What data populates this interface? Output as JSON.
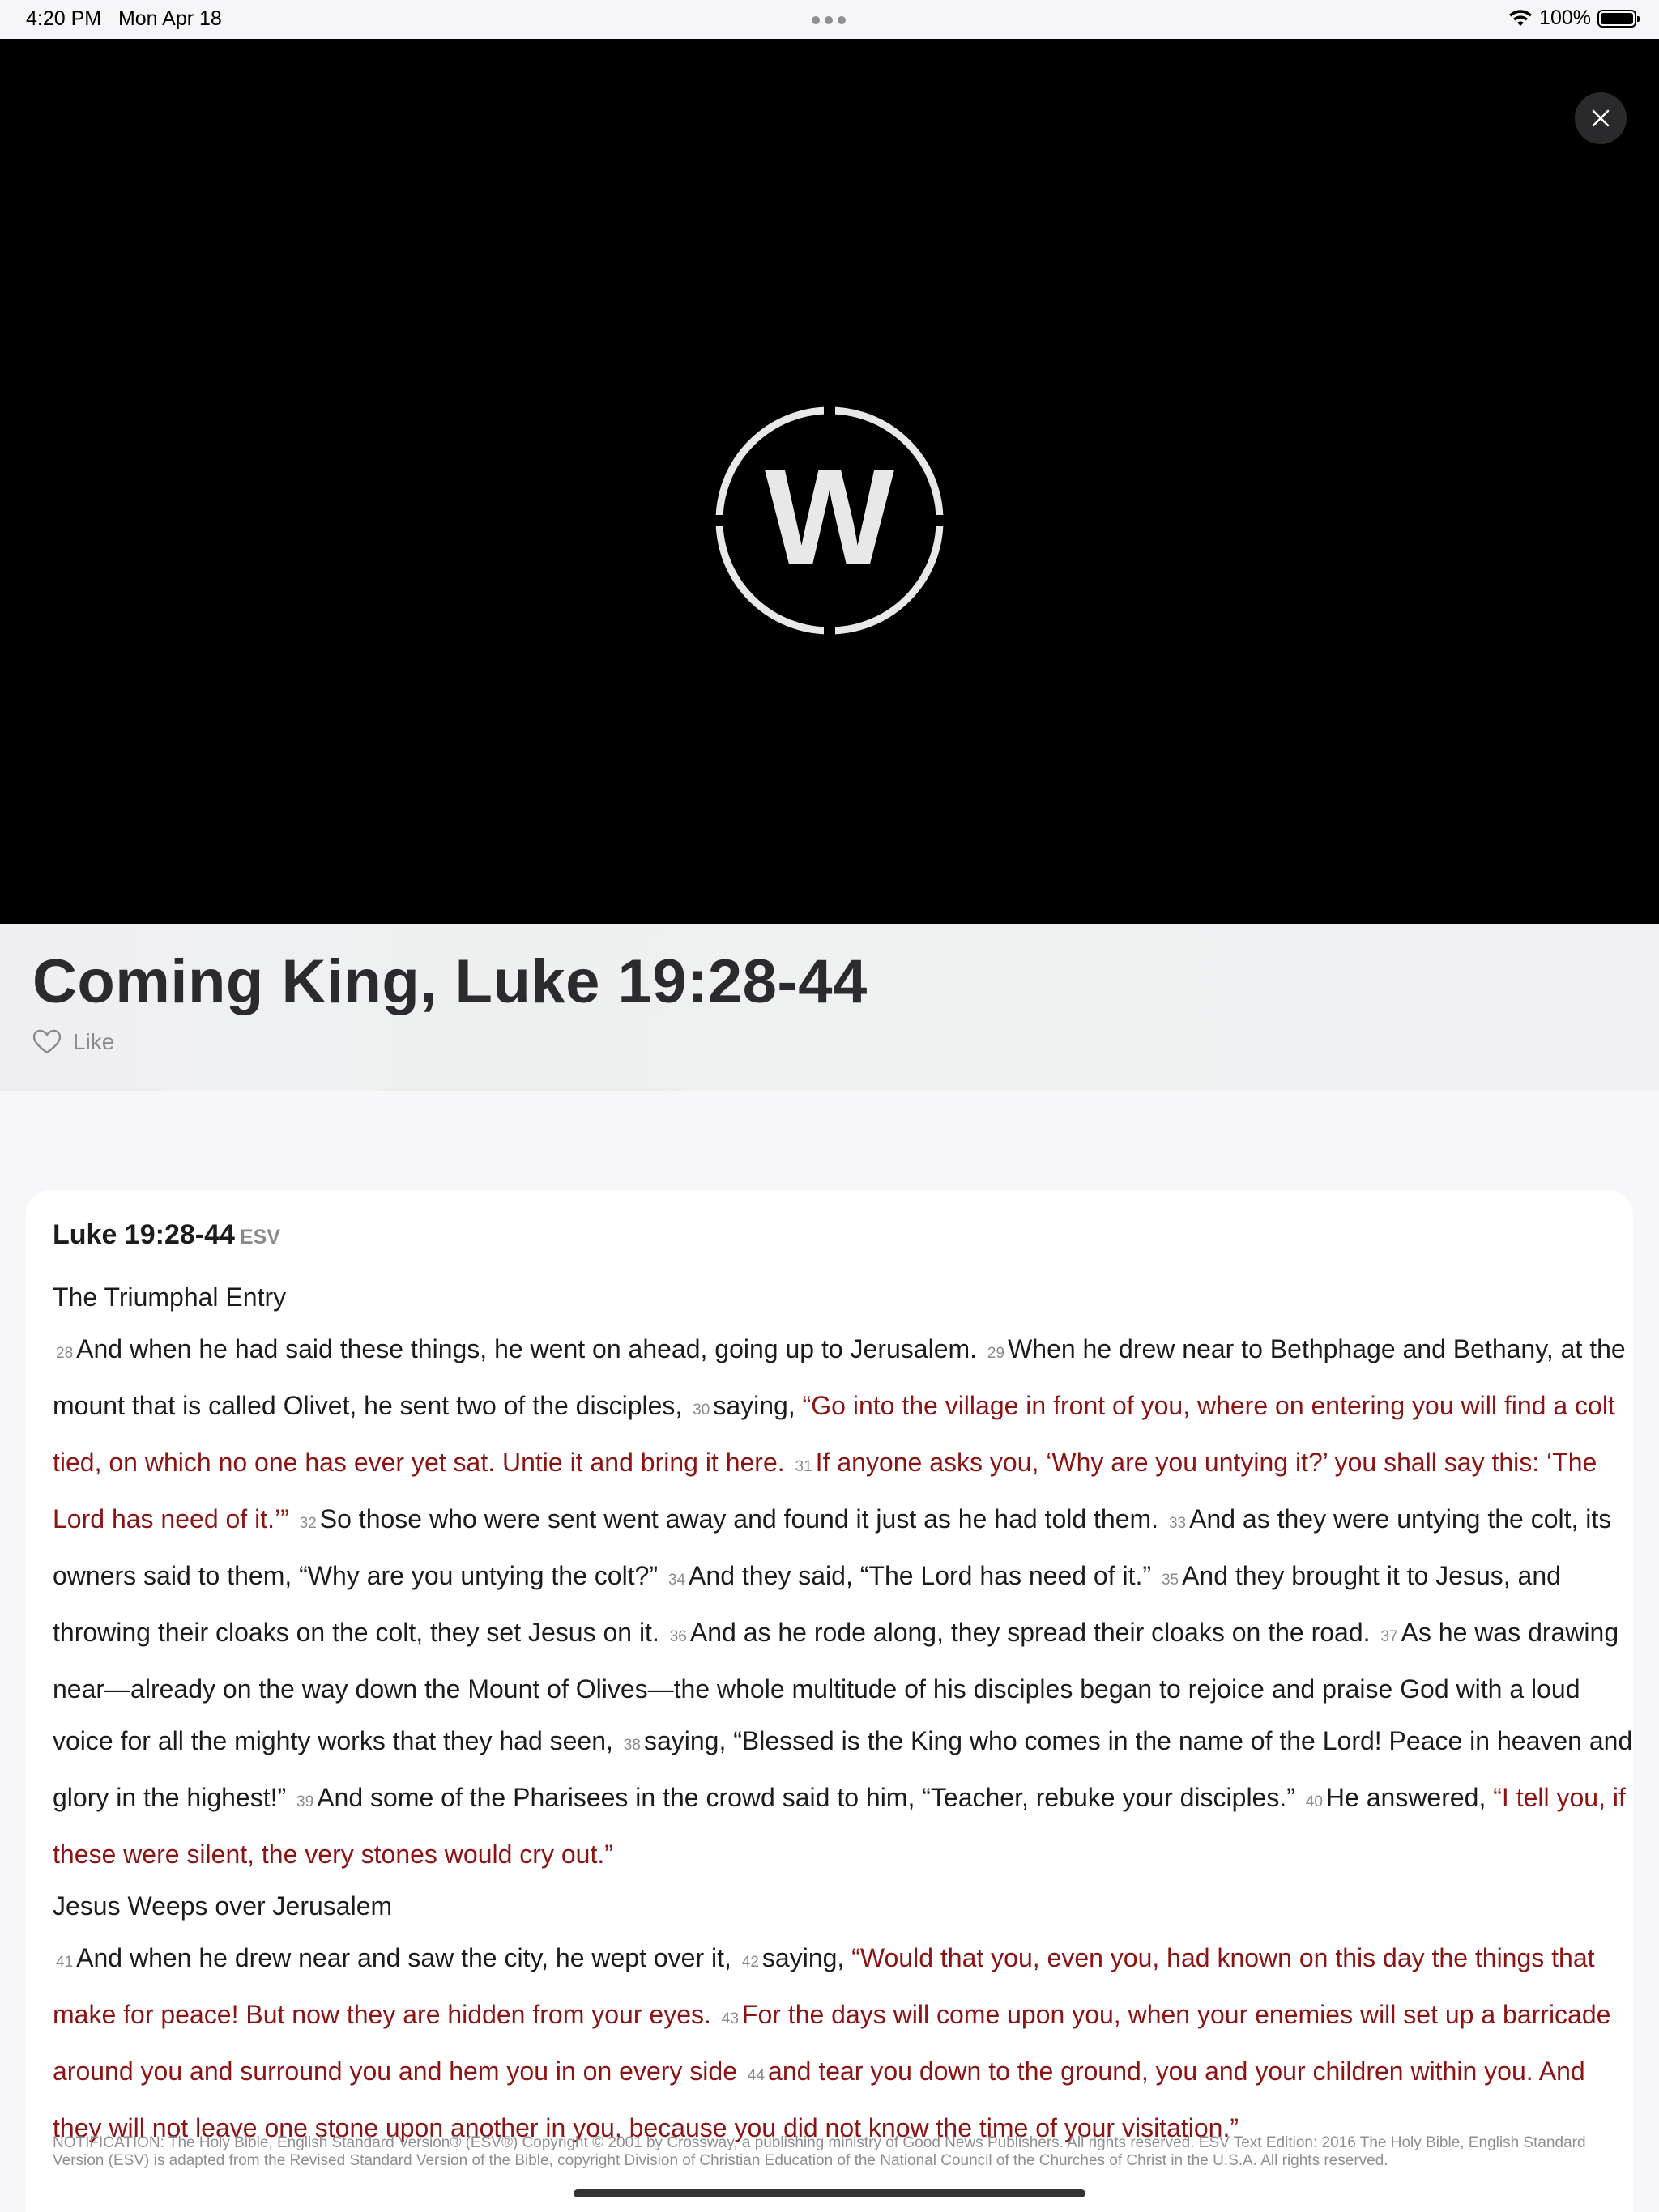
{
  "status_bar": {
    "time": "4:20 PM",
    "date": "Mon Apr 18",
    "battery": "100%"
  },
  "video": {
    "logo_letter": "W"
  },
  "header": {
    "title": "Coming King, Luke 19:28-44",
    "like_label": "Like"
  },
  "passage": {
    "reference": "Luke 19:28-44",
    "version": "ESV",
    "heading1": "The Triumphal Entry",
    "heading2": "Jesus Weeps over Jerusalem",
    "v28": "And when he had said these things, he went on ahead, going up to Jerusalem.",
    "v29": "When he drew near to Bethphage and Bethany, at the mount that is called Olivet, he sent two of the disciples,",
    "v30a": "saying,",
    "v30b": "“Go into the village in front of you, where on entering you will find a colt tied, on which no one has ever yet sat. Untie it and bring it here.",
    "v31": "If anyone asks you, ‘Why are you untying it?’ you shall say this: ‘The Lord has need of it.’”",
    "v32": "So those who were sent went away and found it just as he had told them.",
    "v33": "And as they were untying the colt, its owners said to them, “Why are you untying the colt?”",
    "v34": "And they said, “The Lord has need of it.”",
    "v35": "And they brought it to Jesus, and throwing their cloaks on the colt, they set Jesus on it.",
    "v36": "And as he rode along, they spread their cloaks on the road.",
    "v37": "As he was drawing near—already on the way down the Mount of Olives—the whole multitude of his disciples began to rejoice and praise God with a loud voice for all the mighty works that they had seen,",
    "v38": "saying, “Blessed is the King who comes in the name of the Lord! Peace in heaven and glory in the highest!”",
    "v39": "And some of the Pharisees in the crowd said to him, “Teacher, rebuke your disciples.”",
    "v40a": "He answered,",
    "v40b": "“I tell you, if these were silent, the very stones would cry out.”",
    "v41": "And when he drew near and saw the city, he wept over it,",
    "v42a": "saying,",
    "v42b": "“Would that you, even you, had known on this day the things that make for peace! But now they are hidden from your eyes.",
    "v43": "For the days will come upon you, when your enemies will set up a barricade around you and surround you and hem you in on every side",
    "v44": "and tear you down to the ground, you and your children within you. And they will not leave one stone upon another in you, because you did not know the time of your visitation.”",
    "notice": "NOTIFICATION: The Holy Bible, English Standard Version® (ESV®) Copyright © 2001 by Crossway, a publishing ministry of Good News Publishers. All rights reserved. ESV Text Edition: 2016 The Holy Bible, English Standard Version (ESV) is adapted from the Revised Standard Version of the Bible, copyright Division of Christian Education of the National Council of the Churches of Christ in the U.S.A. All rights reserved."
  },
  "verse_numbers": [
    "28",
    "29",
    "30",
    "31",
    "32",
    "33",
    "34",
    "35",
    "36",
    "37",
    "38",
    "39",
    "40",
    "41",
    "42",
    "43",
    "44"
  ],
  "colors": {
    "words_of_christ": "#8b1414",
    "video_background": "#000000",
    "verse_number": "#8a8a8e"
  }
}
